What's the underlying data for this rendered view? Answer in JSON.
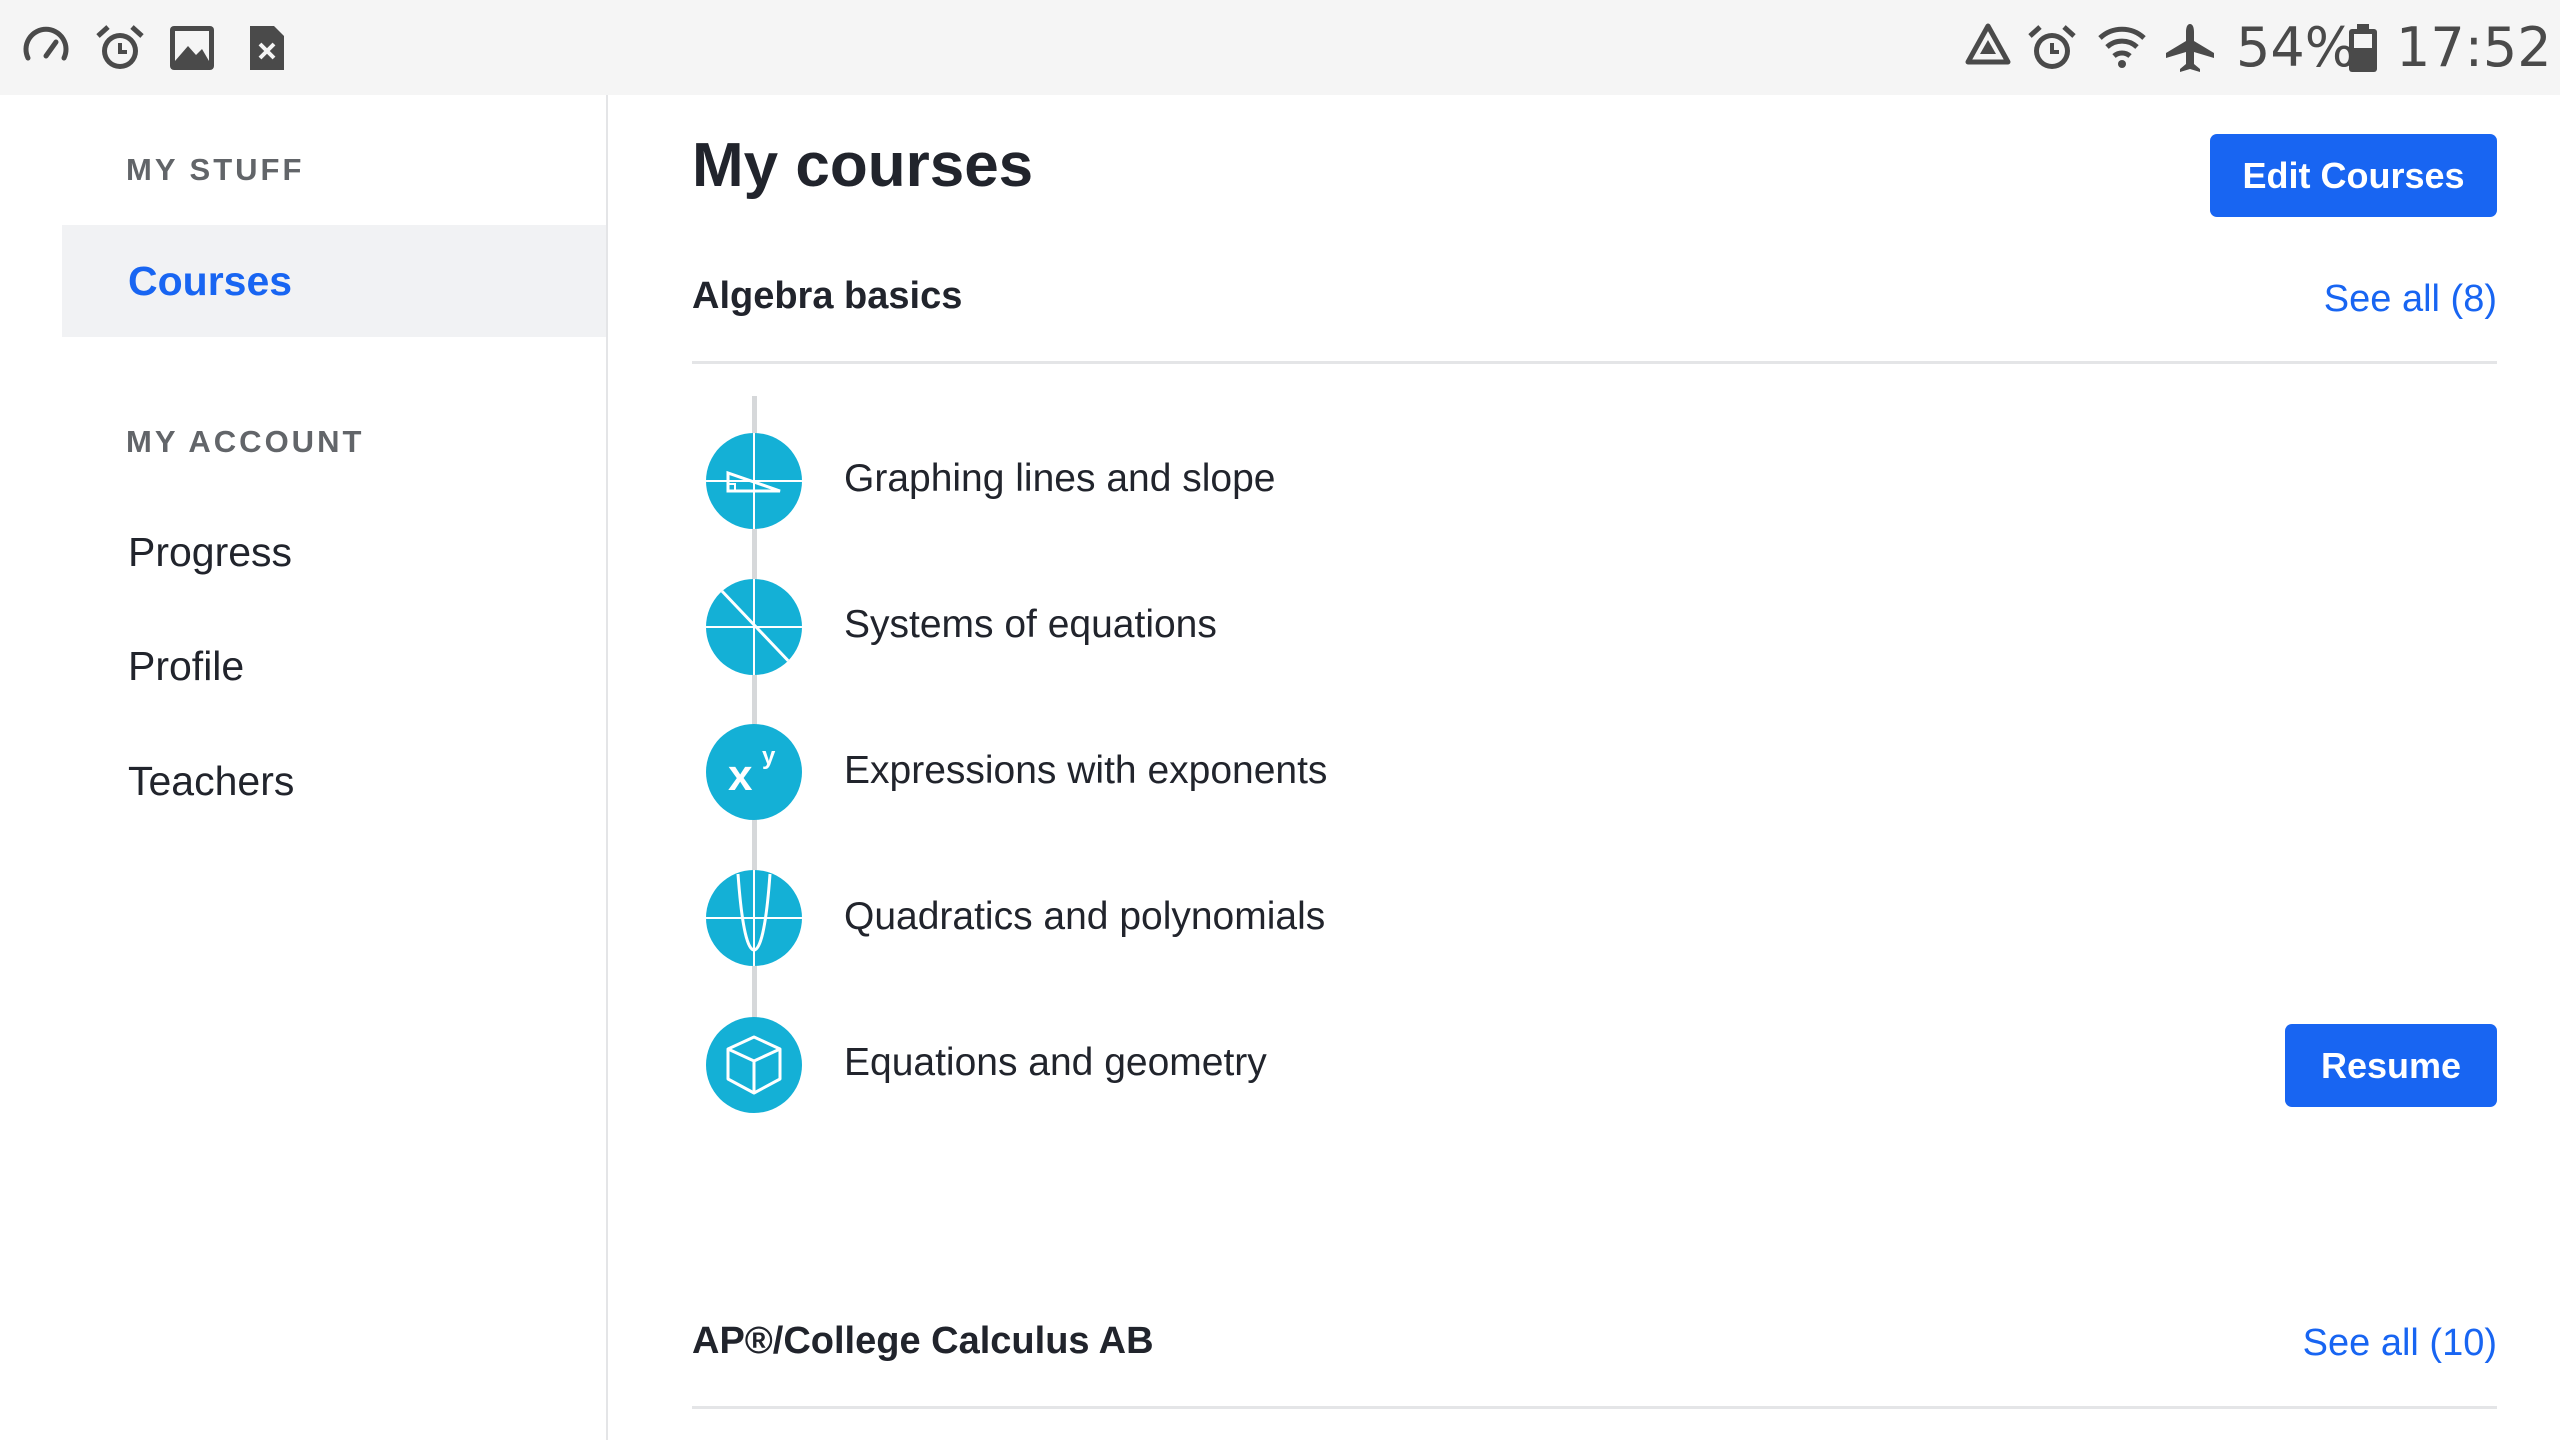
{
  "status_bar": {
    "left_icons": [
      "speedometer-icon",
      "alarm-icon",
      "gallery-icon",
      "sim-error-icon"
    ],
    "right_icons": [
      "recycle-icon",
      "alarm-icon",
      "wifi-icon",
      "airplane-mode-icon",
      "battery-icon"
    ],
    "battery": "54%",
    "time": "17:52"
  },
  "sidebar": {
    "my_stuff_heading": "MY STUFF",
    "courses": "Courses",
    "my_account_heading": "MY ACCOUNT",
    "progress": "Progress",
    "profile": "Profile",
    "teachers": "Teachers"
  },
  "main": {
    "title": "My courses",
    "edit_courses": "Edit Courses",
    "courses": [
      {
        "name": "Algebra basics",
        "see_all": "See all (8)",
        "units": [
          {
            "label": "Graphing lines and slope",
            "icon": "graph-slope-icon"
          },
          {
            "label": "Systems of equations",
            "icon": "systems-icon"
          },
          {
            "label": "Expressions with exponents",
            "icon": "exponent-icon"
          },
          {
            "label": "Quadratics and polynomials",
            "icon": "parabola-icon"
          },
          {
            "label": "Equations and geometry",
            "icon": "cube-icon"
          }
        ],
        "resume": "Resume"
      },
      {
        "name": "AP®/College Calculus AB",
        "see_all": "See all (10)"
      }
    ]
  },
  "colors": {
    "accent": "#1865f2",
    "unit_icon": "#14b0d6",
    "status_bar_bg": "#f5f5f5",
    "sidebar_active_bg": "#f1f2f4"
  }
}
